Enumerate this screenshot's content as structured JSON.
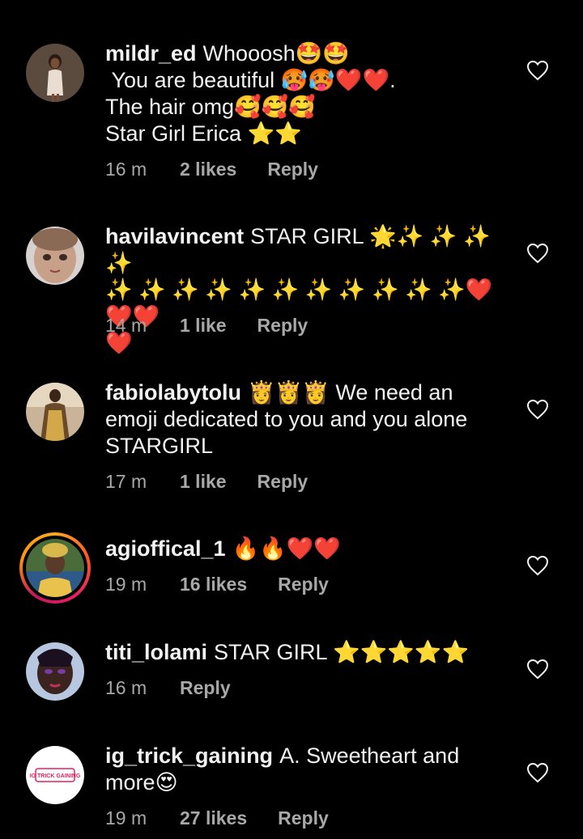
{
  "comments": [
    {
      "username": "mildr_ed",
      "text": "Whooosh🤩🤩\n You are beautiful 🥵🥵❤️❤️.\nThe hair omg🥰🥰🥰\nStar Girl Erica ⭐⭐",
      "time": "16 m",
      "likes": "2 likes",
      "reply": "Reply"
    },
    {
      "username": "havilavincent",
      "text": "STAR GIRL 🌟✨ ✨ ✨ ✨\n✨ ✨ ✨ ✨ ✨ ✨ ✨ ✨ ✨ ✨ ✨❤️❤️❤️\n❤️",
      "time": "14 m",
      "likes": "1 like",
      "reply": "Reply"
    },
    {
      "username": "fabiolabytolu",
      "text": "👸👸👸 We need an emoji dedicated to you and you alone STARGIRL",
      "time": "17 m",
      "likes": "1 like",
      "reply": "Reply"
    },
    {
      "username": "agioffical_1",
      "text": "🔥🔥❤️❤️",
      "time": "19 m",
      "likes": "16 likes",
      "reply": "Reply"
    },
    {
      "username": "titi_lolami",
      "text": "STAR GIRL ⭐⭐⭐⭐⭐",
      "time": "16 m",
      "likes": "",
      "reply": "Reply"
    },
    {
      "username": "ig_trick_gaining",
      "text": "A. Sweetheart and more😍",
      "time": "19 m",
      "likes": "27 likes",
      "reply": "Reply"
    }
  ],
  "avatar_badge_text": "IG TRICK GAINING",
  "colors": {
    "background": "#000000",
    "text": "#f2f2f2",
    "meta": "#a8a8a8",
    "story_ring": [
      "#f9a825",
      "#ff5722",
      "#e91e63"
    ]
  },
  "icons": {
    "like": "heart-outline-icon"
  }
}
